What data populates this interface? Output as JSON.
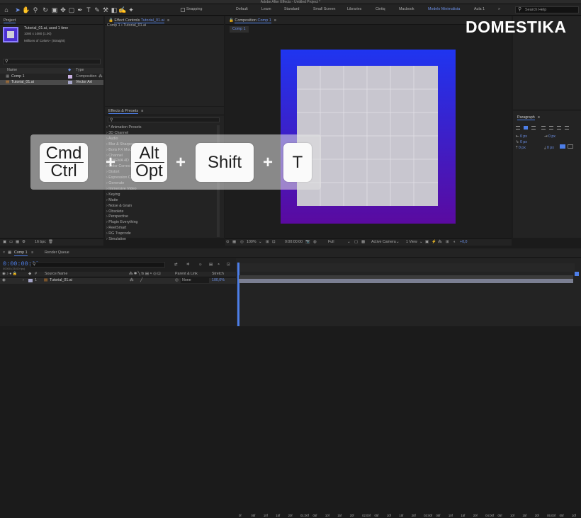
{
  "app": {
    "title": "Adobe After Effects - Untitled Project *"
  },
  "toolbar": {
    "snapping": "Snapping",
    "workspaces": [
      "Default",
      "Learn",
      "Standard",
      "Small Screen",
      "Libraries",
      "Cintiq",
      "Macbook",
      "Modelo Minimalista",
      "Aula 1"
    ],
    "active_workspace": "Modelo Minimalista",
    "search": "Search Help"
  },
  "project": {
    "title": "Project",
    "item_name": "Tutorial_01.ai",
    "item_used": ", used 1 time",
    "item_size": "1080 x 1080 (1.00)",
    "item_colors": "Millions of Colors+ (Straight)",
    "col_name": "Name",
    "col_type": "Type",
    "items": [
      {
        "name": "Comp 1",
        "type": "Composition"
      },
      {
        "name": "Tutorial_01.ai",
        "type": "Vector Art"
      }
    ],
    "bpc": "16 bpc"
  },
  "effect_controls": {
    "tab": "Effect Controls",
    "file": "Tutorial_01.ai",
    "breadcrumb": "Comp 1 • Tutorial_01.ai"
  },
  "effects": {
    "title": "Effects & Presets",
    "items": [
      "* Animation Presets",
      "3D Channel",
      "Audio",
      "Blur & Sharpen",
      "Boris FX Mocha",
      "Channel",
      "CINEMA 4D",
      "Color Correction",
      "Distort",
      "Expression Controls",
      "Generate",
      "Immersive Video",
      "Keying",
      "Matte",
      "Noise & Grain",
      "Obsolete",
      "Perspective",
      "Plugin Everything",
      "ReelSmart",
      "RG Trapcode",
      "Simulation"
    ]
  },
  "composition": {
    "tab": "Composition",
    "tab_name": "Comp 1",
    "subtab": "Comp 1",
    "zoom": "100%",
    "time": "0:00:00:00",
    "resolution": "Full",
    "camera": "Active Camera",
    "view": "1 View",
    "offset": "+0,0"
  },
  "logo": "DOMESTIKA",
  "paragraph": {
    "title": "Paragraph",
    "values": [
      "0 px",
      "0 px",
      "0 px",
      "0 px",
      "0 px"
    ]
  },
  "shortcut": {
    "k1a": "Cmd",
    "k1b": "Ctrl",
    "k2a": "Alt",
    "k2b": "Opt",
    "k3": "Shift",
    "k4": "T",
    "plus": "+"
  },
  "timeline": {
    "tab": "Comp 1",
    "render": "Render Queue",
    "time": "0:00:00:00",
    "frames": "00000 (25.00 fps)",
    "col_source": "Source Name",
    "col_parent": "Parent & Link",
    "col_stretch": "Stretch",
    "layer_num": "1",
    "layer_name": "Tutorial_01.ai",
    "parent": "None",
    "stretch": "100,0%",
    "ruler": [
      "0f",
      "05f",
      "10f",
      "15f",
      "20f",
      "01:00f",
      "05f",
      "10f",
      "15f",
      "20f",
      "02:00f",
      "05f",
      "10f",
      "15f",
      "20f",
      "03:00f",
      "05f",
      "10f",
      "15f",
      "20f",
      "04:00f",
      "05f",
      "10f",
      "15f",
      "20f",
      "05:00f",
      "05f",
      "10f"
    ]
  },
  "colors": {
    "accent": "#4d7ee8",
    "comp_top": "#1f35f0",
    "comp_bottom": "#5a0aa0",
    "grid_fill": "#c8c6cf"
  }
}
